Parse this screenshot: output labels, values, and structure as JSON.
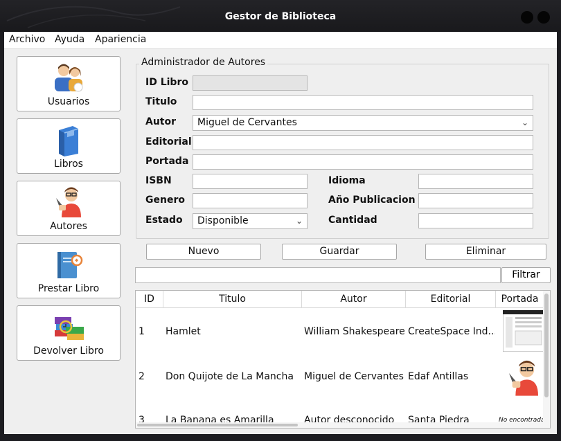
{
  "window": {
    "title": "Gestor de Biblioteca"
  },
  "menu": [
    "Archivo",
    "Ayuda",
    "Apariencia"
  ],
  "nav": [
    {
      "label": "Usuarios",
      "icon": "users-icon"
    },
    {
      "label": "Libros",
      "icon": "book-icon"
    },
    {
      "label": "Autores",
      "icon": "author-icon"
    },
    {
      "label": "Prestar Libro",
      "icon": "lend-book-icon"
    },
    {
      "label": "Devolver Libro",
      "icon": "return-book-icon"
    }
  ],
  "form": {
    "title": "Administrador de Autores",
    "id_label": "ID Libro",
    "id_value": "",
    "titulo_label": "Titulo",
    "titulo_value": "",
    "autor_label": "Autor",
    "autor_value": "Miguel de Cervantes",
    "editorial_label": "Editorial",
    "editorial_value": "",
    "portada_label": "Portada",
    "portada_value": "",
    "isbn_label": "ISBN",
    "isbn_value": "",
    "genero_label": "Genero",
    "genero_value": "",
    "estado_label": "Estado",
    "estado_value": "Disponible",
    "idioma_label": "Idioma",
    "idioma_value": "",
    "anio_label": "Año Publicacion",
    "anio_value": "",
    "cantidad_label": "Cantidad",
    "cantidad_value": ""
  },
  "actions": {
    "nuevo": "Nuevo",
    "guardar": "Guardar",
    "eliminar": "Eliminar",
    "filtrar": "Filtrar"
  },
  "search": {
    "value": ""
  },
  "table": {
    "columns": [
      "ID",
      "Titulo",
      "Autor",
      "Editorial",
      "Portada"
    ],
    "rows": [
      {
        "id": "1",
        "titulo": "Hamlet",
        "autor": "William Shakespeare",
        "editorial": "CreateSpace Ind...",
        "portada": "screenshot-thumbnail"
      },
      {
        "id": "2",
        "titulo": "Don Quijote de La Mancha",
        "autor": "Miguel de Cervantes",
        "editorial": "Edaf Antillas",
        "portada": "author-avatar"
      },
      {
        "id": "3",
        "titulo": "La Banana es Amarilla",
        "autor": "Autor desconocido",
        "editorial": "Santa Piedra",
        "portada": "No encontrada"
      }
    ]
  },
  "colors": {
    "title_bar": "#1c1c20",
    "panel": "#efefef",
    "button_border": "#a8a8a8"
  }
}
